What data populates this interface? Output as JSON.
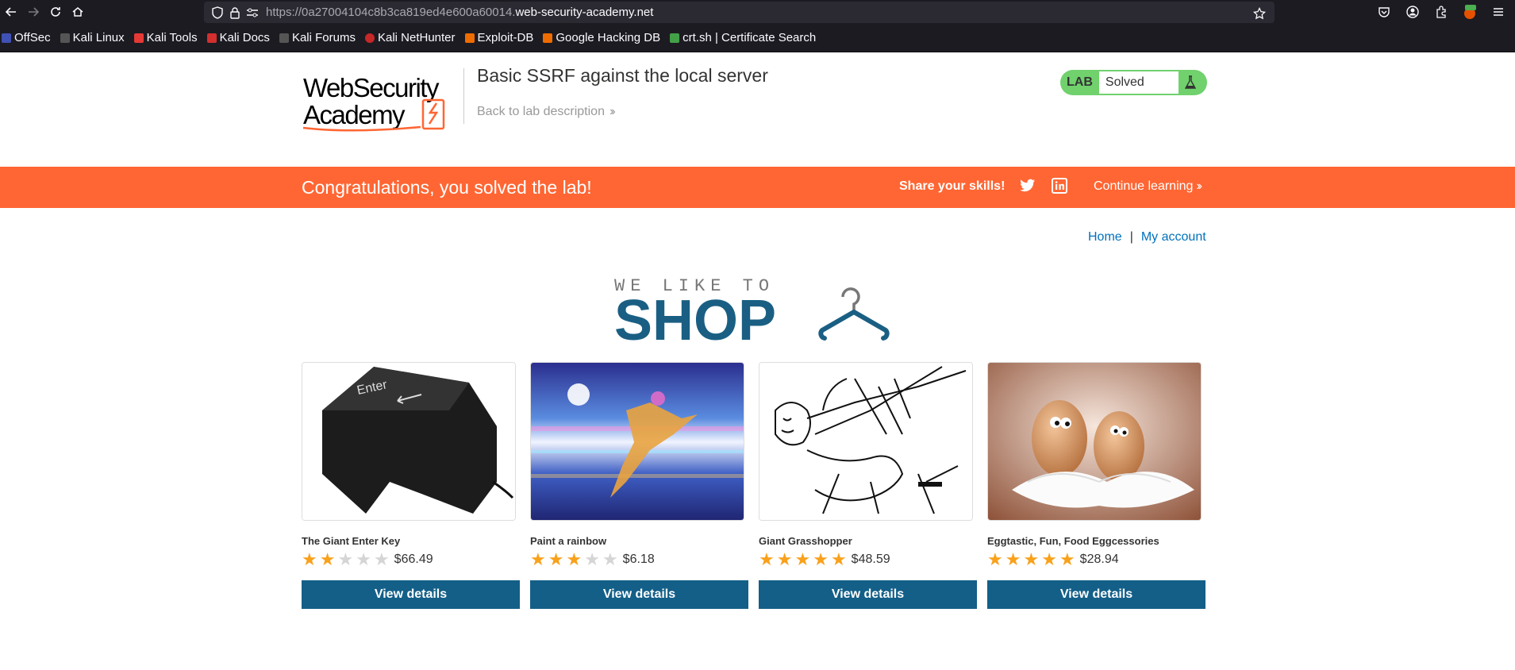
{
  "browser": {
    "url_prefix": "https://0a27004104c8b3ca819ed4e600a60014.",
    "url_domain": "web-security-academy.net",
    "bookmarks": [
      {
        "label": "OffSec",
        "color": "#3f51b5"
      },
      {
        "label": "Kali Linux",
        "color": "#555"
      },
      {
        "label": "Kali Tools",
        "color": "#e53935"
      },
      {
        "label": "Kali Docs",
        "color": "#d32f2f"
      },
      {
        "label": "Kali Forums",
        "color": "#555"
      },
      {
        "label": "Kali NetHunter",
        "color": "#c62828"
      },
      {
        "label": "Exploit-DB",
        "color": "#ef6c00"
      },
      {
        "label": "Google Hacking DB",
        "color": "#ef6c00"
      },
      {
        "label": "crt.sh | Certificate Search",
        "color": "#43a047"
      }
    ]
  },
  "header": {
    "logo_line1": "WebSecurity",
    "logo_line2": "Academy",
    "lab_title": "Basic SSRF against the local server",
    "back_link": "Back to lab description",
    "badge_label": "LAB",
    "badge_status": "Solved"
  },
  "banner": {
    "message": "Congratulations, you solved the lab!",
    "share": "Share your skills!",
    "continue": "Continue learning"
  },
  "nav": {
    "home": "Home",
    "separator": "|",
    "account": "My account"
  },
  "shop": {
    "tagline": "WE LIKE TO",
    "title": "SHOP"
  },
  "products": [
    {
      "name": "The Giant Enter Key",
      "rating": 2,
      "price": "$66.49",
      "button": "View details"
    },
    {
      "name": "Paint a rainbow",
      "rating": 3,
      "price": "$6.18",
      "button": "View details"
    },
    {
      "name": "Giant Grasshopper",
      "rating": 5,
      "price": "$48.59",
      "button": "View details"
    },
    {
      "name": "Eggtastic, Fun, Food Eggcessories",
      "rating": 5,
      "price": "$28.94",
      "button": "View details"
    }
  ],
  "colors": {
    "banner": "#ff6633",
    "button": "#135f88",
    "badge": "#70d16d",
    "star": "#f9a11b",
    "link": "#0071bc"
  }
}
